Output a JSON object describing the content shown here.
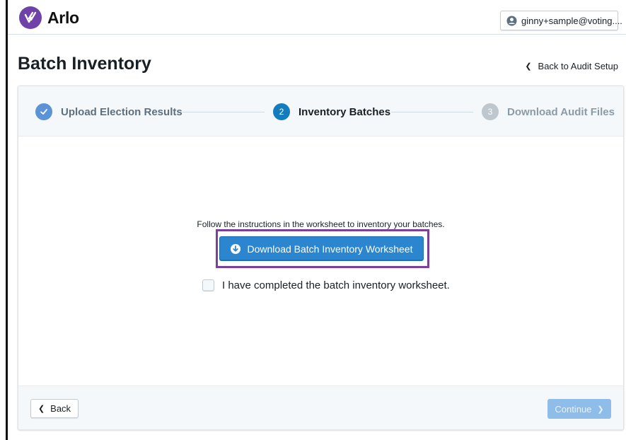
{
  "app": {
    "name": "Arlo",
    "brand_color": "#6e42a8",
    "logo_icon": "arlo-check-logo-icon"
  },
  "header": {
    "user_label": "ginny+sample@voting....",
    "user_icon": "user-icon"
  },
  "page": {
    "title": "Batch Inventory",
    "back_link_label": "Back to Audit Setup"
  },
  "stepper": {
    "steps": [
      {
        "label": "Upload Election Results",
        "state": "completed",
        "number": "1",
        "icon": "checkmark-icon"
      },
      {
        "label": "Inventory Batches",
        "state": "active",
        "number": "2"
      },
      {
        "label": "Download Audit Files",
        "state": "pending",
        "number": "3"
      }
    ]
  },
  "content": {
    "instructions": "Follow the instructions in the worksheet to inventory your batches.",
    "download_button_label": "Download Batch Inventory Worksheet",
    "download_icon": "download-circle-icon",
    "checkbox_label": "I have completed the batch inventory worksheet.",
    "checkbox_checked": false
  },
  "footer": {
    "back_label": "Back",
    "continue_label": "Continue",
    "continue_enabled": false
  },
  "colors": {
    "primary": "#2b86cf",
    "highlight_frame": "#7b3f9c",
    "disabled_primary": "#8dbde8"
  }
}
